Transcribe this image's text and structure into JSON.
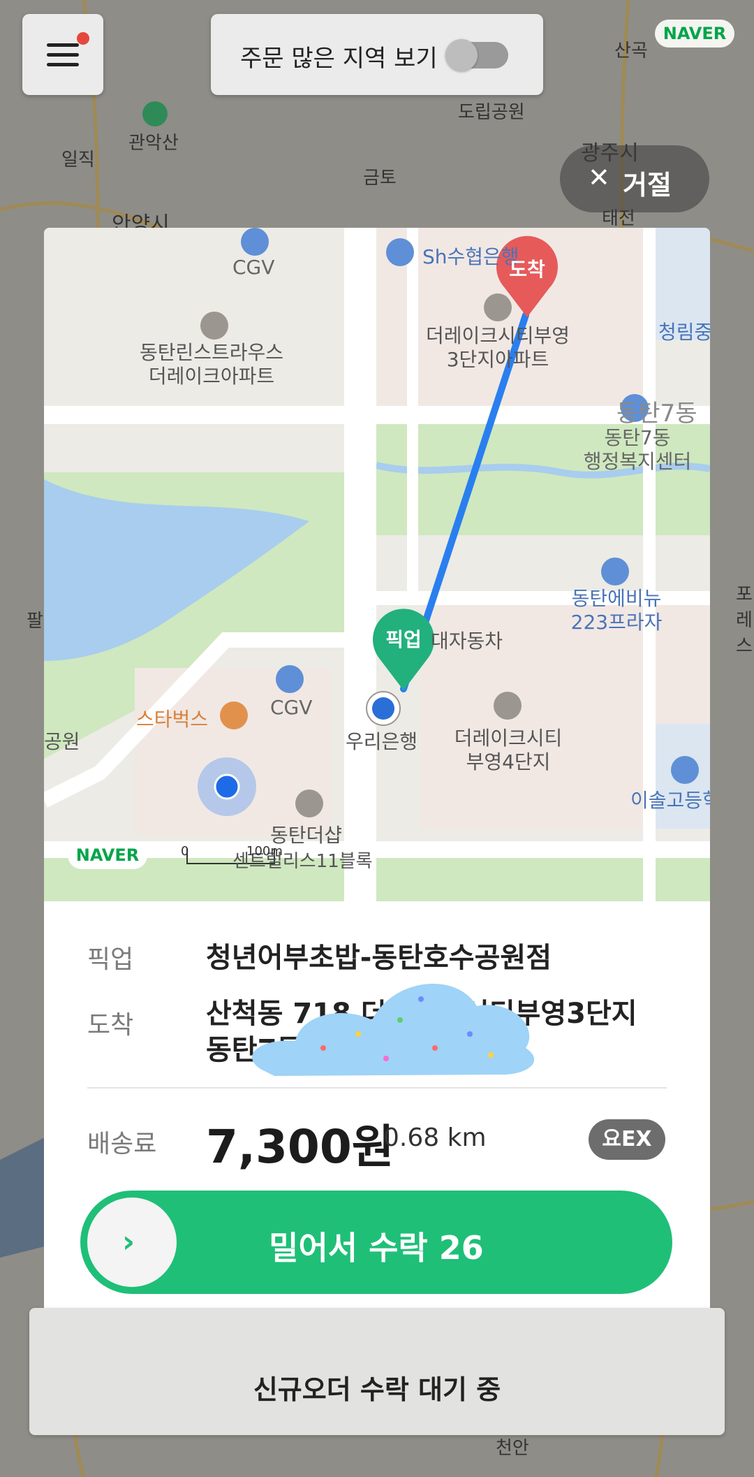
{
  "background_map": {
    "labels": [
      "관악산",
      "일직",
      "금토",
      "산곡",
      "도립공원",
      "광주시",
      "안양시",
      "태전",
      "팔",
      "공원",
      "천안",
      "포레스"
    ]
  },
  "menu": {
    "has_notification": true
  },
  "area_toggle": {
    "label": "주문 많은 지역 보기",
    "enabled": false
  },
  "naver_logo": "NAVER",
  "reject_button": {
    "label": "거절"
  },
  "map": {
    "labels": {
      "cgv_top": "CGV",
      "sh_bank": "Sh수협은행",
      "apt_lake": "동탄린스트라우스\n더레이크아파트",
      "apt_3": "더레이크시티부영\n3단지아파트",
      "cheongnim": "청림중",
      "dongtan7": "동탄7동",
      "dongtan7_center": "동탄7동\n행정복지센터",
      "avenue": "동탄에비뉴\n223프라자",
      "car": "대자동차",
      "starbucks": "스타벅스",
      "cgv_bottom": "CGV",
      "woori": "우리은행",
      "apt_4": "더레이크시티\n부영4단지",
      "ieso": "이솔고등학",
      "park": "공원",
      "dongtan_the": "동탄더샵",
      "centreville": "센트럴리스11블록",
      "scale": "100m",
      "scale_zero": "0"
    },
    "pickup_pin": "픽업",
    "dropoff_pin": "도착",
    "naver_logo": "NAVER",
    "colors": {
      "route": "#2a7fef",
      "pickup": "#22b07d",
      "dropoff": "#e65a5a"
    }
  },
  "details": {
    "pickup_label": "픽업",
    "pickup_value": "청년어부초밥-동탄호수공원점",
    "dropoff_label": "도착",
    "dropoff_line1": "산척동  718 더레이크시티부영3단지",
    "dropoff_line2": "동탄7동",
    "fee_label": "배송료",
    "fee_value": "7,300원",
    "distance": "0.68 km",
    "payment_badge": "요EX"
  },
  "accept_slider": {
    "label": "밀어서 수락 26"
  },
  "waiting_bar": {
    "label": "신규오더 수락 대기 중"
  }
}
